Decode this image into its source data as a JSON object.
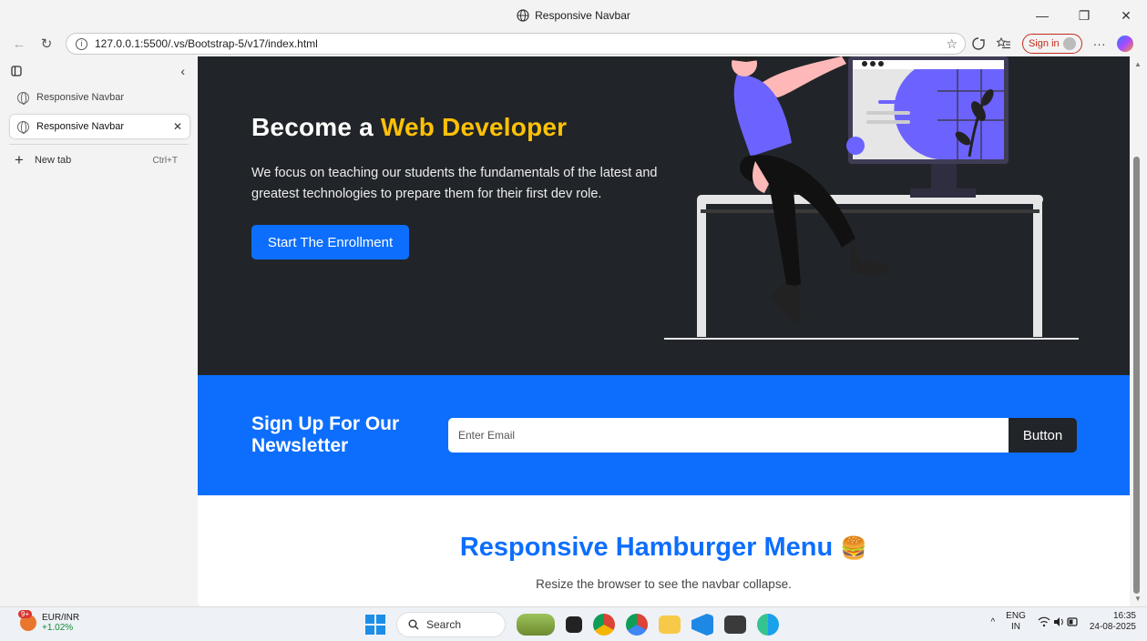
{
  "window": {
    "title": "Responsive Navbar",
    "controls": {
      "minimize": "—",
      "maximize": "❐",
      "close": "✕"
    }
  },
  "toolbar": {
    "back": "←",
    "reload": "↻",
    "url": "127.0.0.1:5500/.vs/Bootstrap-5/v17/index.html",
    "info": "i",
    "favorite": "☆",
    "signin_label": "Sign in",
    "more": "···"
  },
  "sidebar": {
    "tabs": [
      {
        "label": "Responsive Navbar",
        "active": false
      },
      {
        "label": "Responsive Navbar",
        "active": true
      }
    ],
    "close": "✕",
    "collapse": "‹",
    "new_tab_label": "New tab",
    "new_tab_shortcut": "Ctrl+T"
  },
  "hero": {
    "title_plain": "Become a ",
    "title_accent": "Web Developer",
    "description": "We focus on teaching our students the fundamentals of the latest and greatest technologies to prepare them for their first dev role.",
    "cta_label": "Start The Enrollment",
    "accent_color": "#ffc107"
  },
  "newsletter": {
    "heading": "Sign Up For Our Newsletter",
    "input_placeholder": "Enter Email",
    "button_label": "Button",
    "bg_color": "#0d6efd"
  },
  "section": {
    "title": "Responsive Hamburger Menu",
    "emoji": "🍔",
    "subtitle": "Resize the browser to see the navbar collapse."
  },
  "taskbar": {
    "weather_badge": "9+",
    "ticker": "EUR/INR",
    "change": "+1.02%",
    "search_label": "Search",
    "lang_top": "ENG",
    "lang_bottom": "IN",
    "time": "16:35",
    "date": "24-08-2025",
    "tray_chevron": "^"
  }
}
